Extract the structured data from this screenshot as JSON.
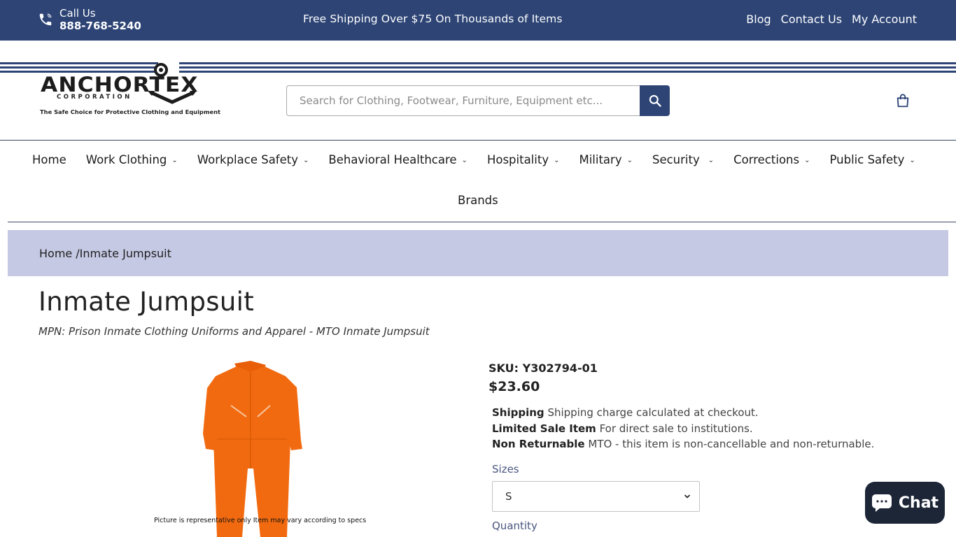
{
  "topbar": {
    "call_label": "Call Us",
    "phone": "888-768-5240",
    "promo": "Free Shipping Over $75 On Thousands of Items",
    "links": [
      "Blog",
      "Contact Us",
      "My Account"
    ]
  },
  "header": {
    "logo": {
      "name": "ANCHORTEX",
      "sub": "CORPORATION",
      "tagline": "The Safe Choice for Protective Clothing and Equipment"
    },
    "search": {
      "placeholder": "Search for Clothing, Footwear, Furniture, Equipment etc...",
      "value": ""
    },
    "icons": {
      "phone": "phone-icon",
      "search": "search-icon",
      "cart": "shopping-bag-icon"
    }
  },
  "nav": {
    "items": [
      {
        "label": "Home",
        "has_dropdown": false
      },
      {
        "label": "Work Clothing",
        "has_dropdown": true
      },
      {
        "label": "Workplace Safety",
        "has_dropdown": true
      },
      {
        "label": "Behavioral Healthcare",
        "has_dropdown": true
      },
      {
        "label": "Hospitality",
        "has_dropdown": true
      },
      {
        "label": "Military",
        "has_dropdown": true
      },
      {
        "label": "Security",
        "has_dropdown": true
      },
      {
        "label": "Corrections",
        "has_dropdown": true
      },
      {
        "label": "Public Safety",
        "has_dropdown": true
      }
    ],
    "second_row": "Brands"
  },
  "breadcrumb": {
    "home": "Home",
    "separator": "/",
    "current": "Inmate Jumpsuit"
  },
  "product": {
    "title": "Inmate Jumpsuit",
    "mpn": "MPN: Prison Inmate Clothing Uniforms and Apparel - MTO Inmate Jumpsuit",
    "image_caption": "Picture is representative only Item may vary according to specs",
    "image_color": "#f26a10",
    "sku": "SKU: Y302794-01",
    "price": "$23.60",
    "info": [
      {
        "label": "Shipping",
        "text": "Shipping charge calculated at checkout."
      },
      {
        "label": "Limited Sale Item",
        "text": "For direct sale to institutions."
      },
      {
        "label": "Non Returnable",
        "text": "MTO - this item is non-cancellable and non-returnable."
      }
    ],
    "sizes_label": "Sizes",
    "size_selected": "S",
    "quantity_label": "Quantity"
  },
  "chat": {
    "label": "Chat"
  },
  "colors": {
    "brand_navy": "#2d4475",
    "breadcrumb_bg": "#c6c9e4",
    "chat_bg": "#1c2636"
  }
}
